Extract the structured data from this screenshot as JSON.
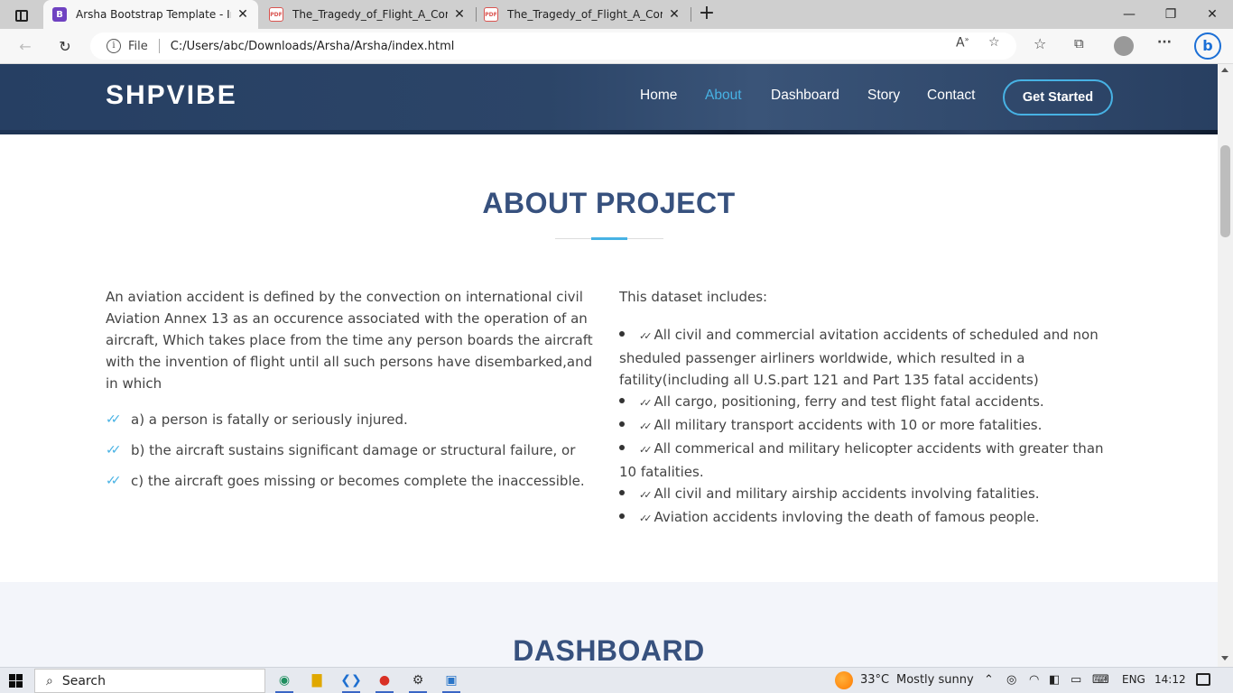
{
  "browser": {
    "tabs": [
      {
        "title": "Arsha Bootstrap Template - Index",
        "favicon": "B"
      },
      {
        "title": "The_Tragedy_of_Flight_A_Comprehensive",
        "favicon": "PDF"
      },
      {
        "title": "The_Tragedy_of_Flight_A_Comprehensive",
        "favicon": "PDF"
      }
    ],
    "address": {
      "protocol_label": "File",
      "url": "C:/Users/abc/Downloads/Arsha/Arsha/index.html"
    }
  },
  "site": {
    "logo": "SHPVIBE",
    "nav": [
      "Home",
      "About",
      "Dashboard",
      "Story",
      "Contact"
    ],
    "active_nav": "About",
    "cta": "Get Started"
  },
  "about": {
    "title": "ABOUT PROJECT",
    "intro": "An aviation accident is defined by the convection on international civil Aviation Annex 13 as an occurence associated with the operation of an aircraft, Which takes place from the time any person boards the aircraft with the invention of flight until all such persons have disembarked,and in which",
    "conditions": [
      "a) a person is fatally or seriously injured.",
      "b) the aircraft sustains significant damage or structural failure, or",
      "c) the aircraft goes missing or becomes complete the inaccessible."
    ],
    "dataset_heading": "This dataset includes:",
    "dataset_items": [
      "All civil and commercial avitation accidents of scheduled and non sheduled passenger airliners worldwide, which resulted in a fatility(including all U.S.part 121 and Part 135 fatal accidents)",
      "All cargo, positioning, ferry and test flight fatal accidents.",
      "All military transport accidents with 10 or more fatalities.",
      "All commerical and military helicopter accidents with greater than 10 fatalities.",
      "All civil and military airship accidents involving fatalities.",
      "Aviation accidents invloving the death of famous people."
    ]
  },
  "dashboard": {
    "title": "DASHBOARD"
  },
  "taskbar": {
    "search_label": "Search",
    "weather": "33°C",
    "weather_desc": "Mostly sunny",
    "lang": "ENG",
    "time": "14:12"
  },
  "colors": {
    "accent": "#47b2e4",
    "heading": "#37517e",
    "header_bg": "#2c4568"
  }
}
